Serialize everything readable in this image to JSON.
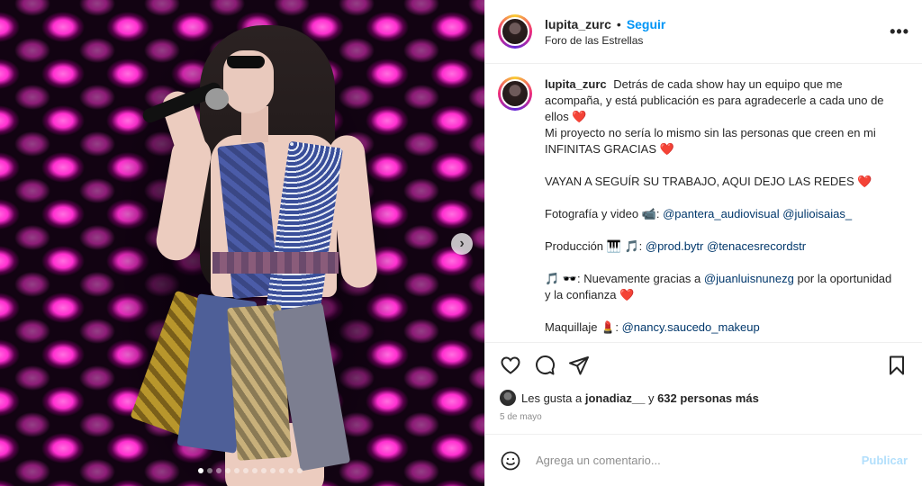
{
  "post": {
    "username": "lupita_zurc",
    "separator": "•",
    "follow_label": "Seguir",
    "location": "Foro de las Estrellas",
    "more_label": "•••"
  },
  "media": {
    "next_label": "›",
    "dot_count": 12,
    "active_dot": 0
  },
  "caption": {
    "username": "lupita_zurc",
    "line1": "Detrás de cada show hay un equipo que me acompaña, y está publicación es para agradecerle a cada uno de ellos",
    "line2": "Mi proyecto no sería lo mismo sin las personas que creen en mi INFINITAS GRACIAS",
    "line3": "VAYAN A SEGUÍR SU TRABAJO, AQUI DEJO LAS REDES",
    "foto_label": "Fotografía y video 📹:",
    "foto_m1": "@pantera_audiovisual",
    "foto_m2": "@julioisaias_",
    "prod_label": "Producción 🎹 🎵:",
    "prod_m1": "@prod.bytr",
    "prod_m2": "@tenacesrecordstr",
    "nuev_label": "🎵 🕶️: Nuevamente gracias a",
    "nuev_m1": "@juanluisnunezg",
    "nuev_tail": "por la oportunidad y la confianza",
    "maq_label": "Maquillaje 💄:",
    "maq_m1": "@nancy.saucedo_makeup",
    "heart": "❤️"
  },
  "likes": {
    "prefix": "Les gusta a",
    "user": "jonadiaz__",
    "connector": "y",
    "count": "632 personas más"
  },
  "date": "5 de mayo",
  "comment": {
    "placeholder": "Agrega un comentario...",
    "publish_label": "Publicar"
  },
  "colors": {
    "accent": "#0095f6",
    "mention": "#00376b",
    "heart": "#ed1c24",
    "publish_disabled": "#b2dffc"
  }
}
